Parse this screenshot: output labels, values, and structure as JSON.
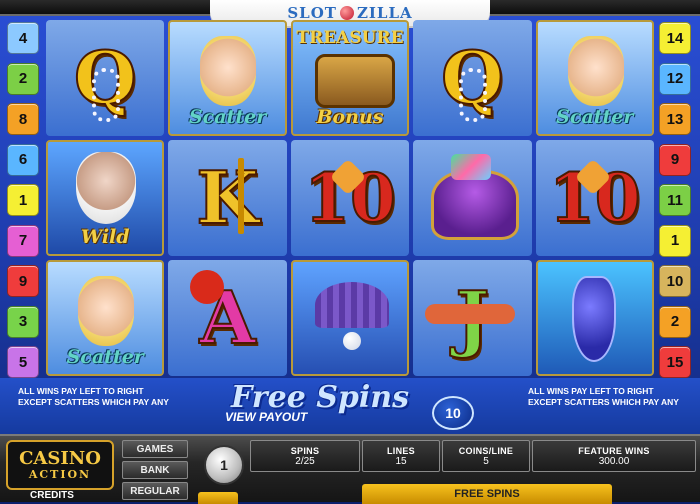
{
  "site_logo": {
    "text_left": "SLOT",
    "text_right": "ZILLA"
  },
  "paylines_left": [
    {
      "n": "4",
      "color": "#8cc9ff"
    },
    {
      "n": "2",
      "color": "#7ccf46"
    },
    {
      "n": "8",
      "color": "#f4a125"
    },
    {
      "n": "6",
      "color": "#5ab6ff"
    },
    {
      "n": "1",
      "color": "#f5ef33"
    },
    {
      "n": "7",
      "color": "#e55fd3"
    },
    {
      "n": "9",
      "color": "#ef3c3c"
    },
    {
      "n": "3",
      "color": "#78d34a"
    },
    {
      "n": "5",
      "color": "#c874e8"
    }
  ],
  "paylines_right": [
    {
      "n": "14",
      "color": "#f5ef33"
    },
    {
      "n": "12",
      "color": "#5ab6ff"
    },
    {
      "n": "13",
      "color": "#f4a125"
    },
    {
      "n": "9",
      "color": "#ef3c3c"
    },
    {
      "n": "11",
      "color": "#7ccf46"
    },
    {
      "n": "1",
      "color": "#f5ef33"
    },
    {
      "n": "10",
      "color": "#d7b45d"
    },
    {
      "n": "2",
      "color": "#f4a125"
    },
    {
      "n": "15",
      "color": "#ef3c3c"
    }
  ],
  "reels": {
    "r1c1": {
      "symbol": "Q"
    },
    "r1c2": {
      "label": "Scatter"
    },
    "r1c3": {
      "top": "TREASURE",
      "label": "Bonus"
    },
    "r1c4": {
      "symbol": "Q"
    },
    "r1c5": {
      "label": "Scatter"
    },
    "r2c1": {
      "label": "Wild"
    },
    "r2c2": {
      "symbol": "K"
    },
    "r2c3": {
      "symbol": "10"
    },
    "r2c5": {
      "symbol": "10"
    },
    "r3c1": {
      "label": "Scatter"
    },
    "r3c2": {
      "symbol": "A"
    },
    "r3c4": {
      "symbol": "J"
    }
  },
  "info": {
    "rule_left": "ALL WINS PAY LEFT TO RIGHT EXCEPT SCATTERS WHICH PAY ANY",
    "rule_right": "ALL WINS PAY LEFT TO RIGHT EXCEPT SCATTERS WHICH PAY ANY",
    "free_spins_title": "Free Spins",
    "view_payout": "VIEW PAYOUT",
    "free_spins_count": "10"
  },
  "console": {
    "logo_line1": "CASINO",
    "logo_line2": "ACTION",
    "credits_label": "CREDITS",
    "menu": [
      "GAMES",
      "BANK",
      "REGULAR"
    ],
    "coin_value": "1",
    "panels": [
      {
        "label": "SPINS",
        "value": "2/25"
      },
      {
        "label": "LINES",
        "value": "15"
      },
      {
        "label": "COINS/LINE",
        "value": "5"
      },
      {
        "label": "FEATURE WINS",
        "value": "300.00"
      }
    ],
    "spin_button": "FREE SPINS"
  }
}
